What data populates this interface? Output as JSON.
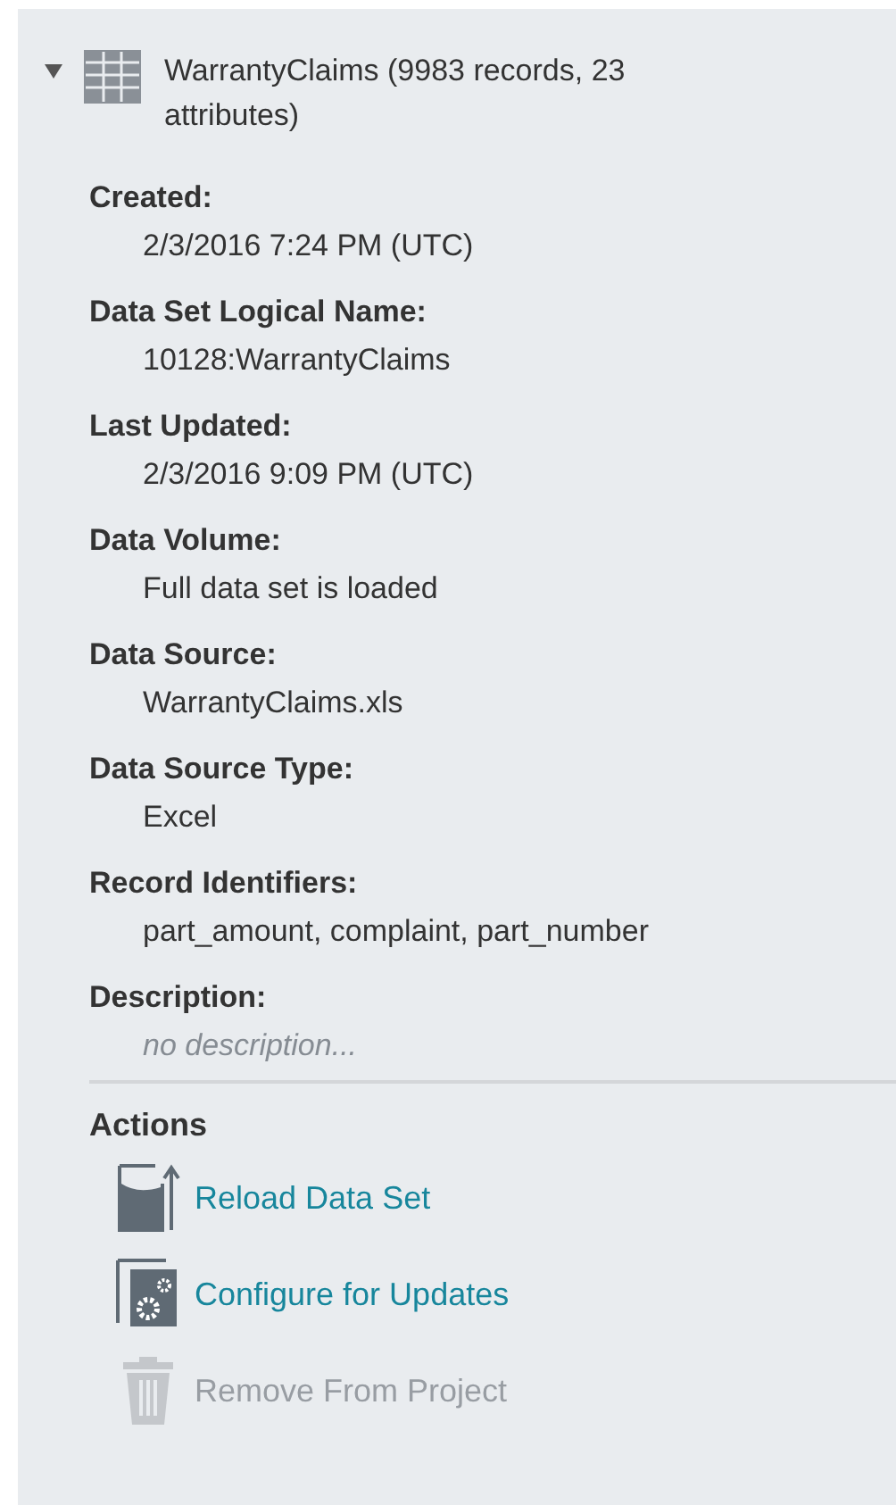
{
  "dataset": {
    "title": "WarrantyClaims (9983 records, 23 attributes)",
    "expanded": true
  },
  "fields": [
    {
      "label": "Created:",
      "value": "2/3/2016 7:24 PM (UTC)",
      "kind": "text"
    },
    {
      "label": "Data Set Logical Name:",
      "value": "10128:WarrantyClaims",
      "kind": "text"
    },
    {
      "label": "Last Updated:",
      "value": "2/3/2016 9:09 PM (UTC)",
      "kind": "text"
    },
    {
      "label": "Data Volume:",
      "value": "Full data set is loaded",
      "kind": "text"
    },
    {
      "label": "Data Source:",
      "value": "WarrantyClaims.xls",
      "kind": "text"
    },
    {
      "label": "Data Source Type:",
      "value": "Excel",
      "kind": "text"
    },
    {
      "label": "Record Identifiers:",
      "value": "part_amount, complaint, part_number",
      "kind": "text"
    },
    {
      "label": "Description:",
      "value": "no description...",
      "kind": "empty"
    }
  ],
  "actions": {
    "title": "Actions",
    "items": [
      {
        "label": "Reload Data Set",
        "kind": "reload",
        "disabled": false
      },
      {
        "label": "Configure for Updates",
        "kind": "configure",
        "disabled": false
      },
      {
        "label": "Remove From Project",
        "kind": "remove",
        "disabled": true
      }
    ]
  }
}
